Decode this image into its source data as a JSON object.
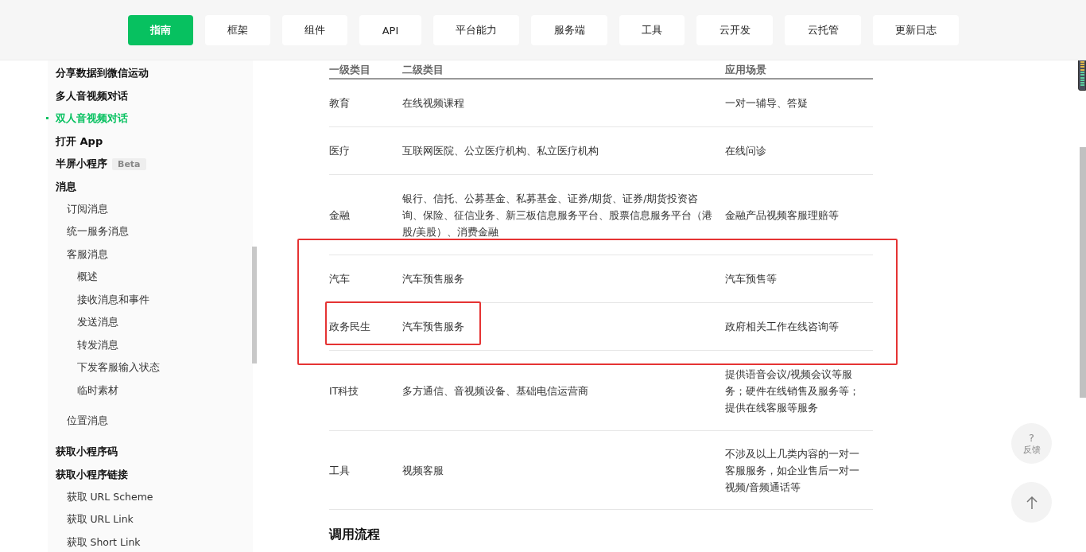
{
  "nav": [
    {
      "label": "指南",
      "selected": true
    },
    {
      "label": "框架",
      "selected": false
    },
    {
      "label": "组件",
      "selected": false
    },
    {
      "label": "API",
      "selected": false
    },
    {
      "label": "平台能力",
      "selected": false
    },
    {
      "label": "服务端",
      "selected": false
    },
    {
      "label": "工具",
      "selected": false
    },
    {
      "label": "云开发",
      "selected": false
    },
    {
      "label": "云托管",
      "selected": false
    },
    {
      "label": "更新日志",
      "selected": false
    }
  ],
  "sidebar": {
    "items": [
      {
        "label": "分享数据到微信运动",
        "selected": false
      },
      {
        "label": "多人音视频对话",
        "selected": false
      },
      {
        "label": "双人音视频对话",
        "selected": true
      },
      {
        "label": "打开 App",
        "selected": false
      },
      {
        "label": "半屏小程序",
        "badge": "Beta",
        "selected": false
      },
      {
        "label": "消息",
        "selected": false,
        "children": [
          {
            "label": "订阅消息",
            "selected": false
          },
          {
            "label": "统一服务消息",
            "selected": false
          },
          {
            "label": "客服消息",
            "selected": false,
            "children": [
              {
                "label": "概述",
                "selected": false
              },
              {
                "label": "接收消息和事件",
                "selected": false
              },
              {
                "label": "发送消息",
                "selected": false
              },
              {
                "label": "转发消息",
                "selected": false
              },
              {
                "label": "下发客服输入状态",
                "selected": false
              },
              {
                "label": "临时素材",
                "selected": false
              }
            ]
          },
          {
            "label": "位置消息",
            "selected": false
          }
        ]
      },
      {
        "label": "获取小程序码",
        "selected": false
      },
      {
        "label": "获取小程序链接",
        "selected": false,
        "children": [
          {
            "label": "获取 URL Scheme",
            "selected": false
          },
          {
            "label": "获取 URL Link",
            "selected": false
          },
          {
            "label": "获取 Short Link",
            "selected": false
          }
        ]
      }
    ]
  },
  "table": {
    "columns": [
      "一级类目",
      "二级类目",
      "应用场景"
    ],
    "rows": [
      [
        "教育",
        "在线视频课程",
        "一对一辅导、答疑"
      ],
      [
        "医疗",
        "互联网医院、公立医疗机构、私立医疗机构",
        "在线问诊"
      ],
      [
        "金融",
        "银行、信托、公募基金、私募基金、证券/期货、证券/期货投资咨询、保险、征信业务、新三板信息服务平台、股票信息服务平台（港股/美股）、消费金融",
        "金融产品视频客服理赔等"
      ],
      [
        "汽车",
        "汽车预售服务",
        "汽车预售等"
      ],
      [
        "政务民生",
        "汽车预售服务",
        "政府相关工作在线咨询等"
      ],
      [
        "IT科技",
        "多方通信、音视频设备、基础电信运营商",
        "提供语音会议/视频会议等服务；硬件在线销售及服务等；提供在线客服等服务"
      ],
      [
        "工具",
        "视频客服",
        "不涉及以上几类内容的一对一客服服务，如企业售后一对一视频/音频通话等"
      ]
    ]
  },
  "section_heading": "调用流程",
  "feedback": {
    "symbol": "?",
    "label": "反馈"
  }
}
